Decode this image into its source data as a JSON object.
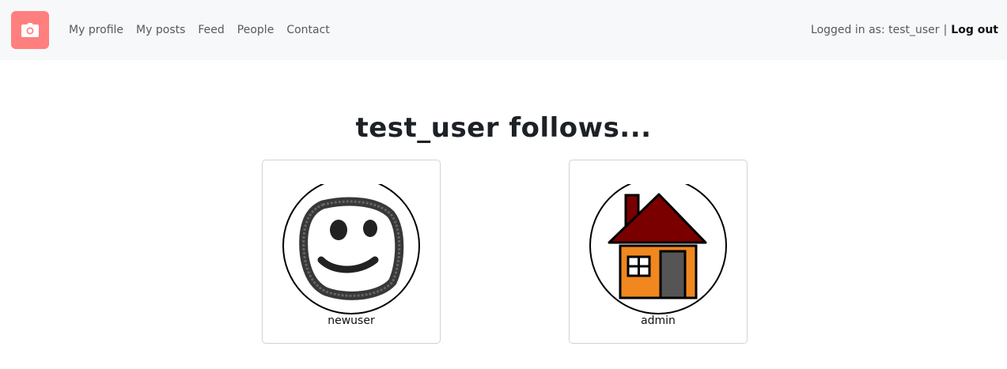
{
  "nav": {
    "brand_icon": "camera-icon",
    "brand_color": "#ff7f7f",
    "links": [
      "My profile",
      "My posts",
      "Feed",
      "People",
      "Contact"
    ],
    "logged_in_text": "Logged in as: test_user",
    "separator": "|",
    "logout_label": "Log out"
  },
  "main": {
    "heading": "test_user follows..."
  },
  "follows": [
    {
      "username": "newuser",
      "avatar_icon": "smiley-face-icon"
    },
    {
      "username": "admin",
      "avatar_icon": "house-icon"
    }
  ]
}
